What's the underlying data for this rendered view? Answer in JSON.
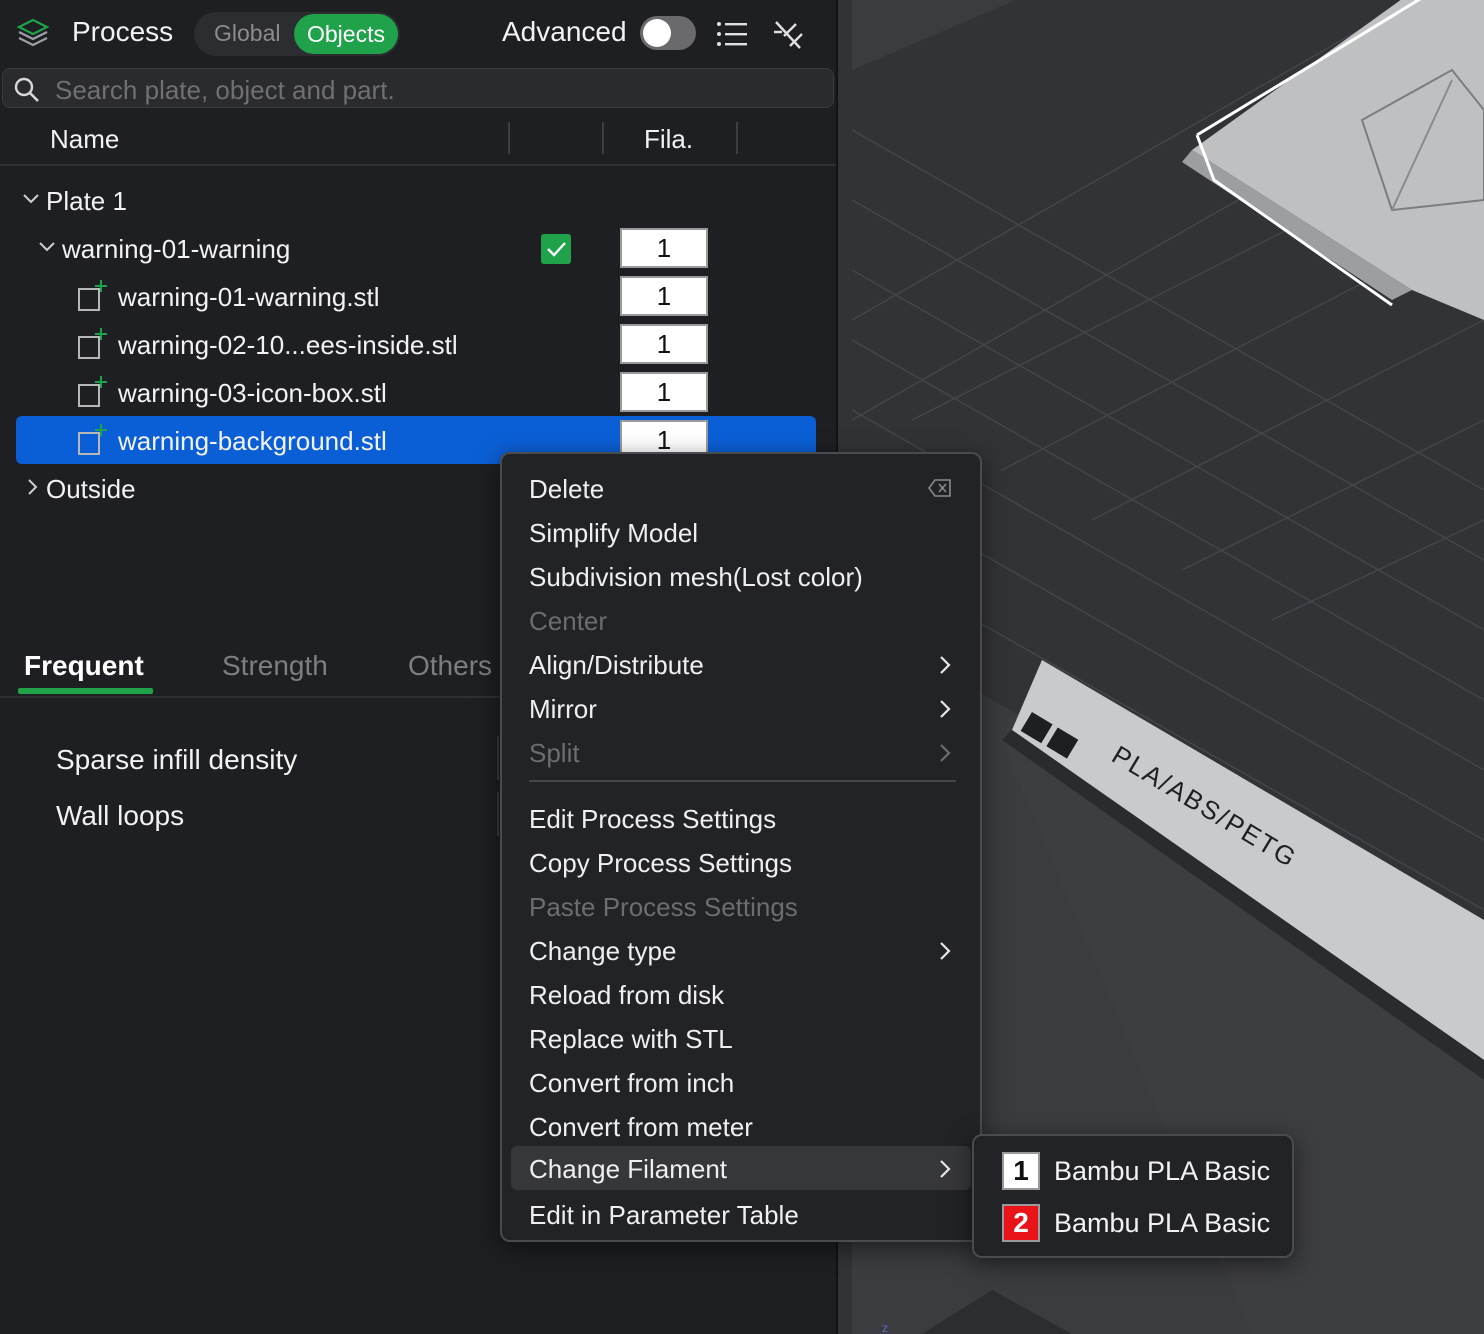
{
  "header": {
    "title": "Process",
    "segment_global": "Global",
    "segment_objects": "Objects",
    "advanced_label": "Advanced",
    "advanced_enabled": false
  },
  "search": {
    "placeholder": "Search plate, object and part."
  },
  "columns": {
    "name": "Name",
    "filament": "Fila."
  },
  "tree": {
    "plate": "Plate 1",
    "object": {
      "name": "warning-01-warning",
      "filament": "1",
      "checked": true
    },
    "parts": [
      {
        "name": "warning-01-warning.stl",
        "filament": "1"
      },
      {
        "name": "warning-02-10...ees-inside.stl",
        "filament": "1"
      },
      {
        "name": "warning-03-icon-box.stl",
        "filament": "1"
      },
      {
        "name": "warning-background.stl",
        "filament": "1",
        "selected": true
      }
    ],
    "outside": "Outside"
  },
  "tabs": [
    "Frequent",
    "Strength",
    "Others"
  ],
  "active_tab": "Frequent",
  "params": [
    "Sparse infill density",
    "Wall loops"
  ],
  "bed_label": "PLA/ABS/PETG",
  "context_menu": {
    "items": [
      {
        "label": "Delete",
        "disabled": false,
        "submenu": false
      },
      {
        "label": "Simplify Model",
        "disabled": false,
        "submenu": false
      },
      {
        "label": "Subdivision mesh(Lost color)",
        "disabled": false,
        "submenu": false
      },
      {
        "label": "Center",
        "disabled": true,
        "submenu": false
      },
      {
        "label": "Align/Distribute",
        "disabled": false,
        "submenu": true
      },
      {
        "label": "Mirror",
        "disabled": false,
        "submenu": true
      },
      {
        "label": "Split",
        "disabled": true,
        "submenu": true
      },
      {
        "label": "Edit Process Settings",
        "disabled": false,
        "submenu": false
      },
      {
        "label": "Copy Process Settings",
        "disabled": false,
        "submenu": false
      },
      {
        "label": "Paste Process Settings",
        "disabled": true,
        "submenu": false
      },
      {
        "label": "Change type",
        "disabled": false,
        "submenu": true
      },
      {
        "label": "Reload from disk",
        "disabled": false,
        "submenu": false
      },
      {
        "label": "Replace with STL",
        "disabled": false,
        "submenu": false
      },
      {
        "label": "Convert from inch",
        "disabled": false,
        "submenu": false
      },
      {
        "label": "Convert from meter",
        "disabled": false,
        "submenu": false
      },
      {
        "label": "Change Filament",
        "disabled": false,
        "submenu": true,
        "highlighted": true
      },
      {
        "label": "Edit in Parameter Table",
        "disabled": false,
        "submenu": false
      }
    ]
  },
  "filament_submenu": [
    {
      "index": "1",
      "name": "Bambu PLA Basic",
      "color": "#ffffff",
      "text_color": "#111111"
    },
    {
      "index": "2",
      "name": "Bambu PLA Basic",
      "color": "#e8141a",
      "text_color": "#ffffff"
    }
  ],
  "colors": {
    "accent": "#1fa24a",
    "selection": "#0b5fd6"
  }
}
